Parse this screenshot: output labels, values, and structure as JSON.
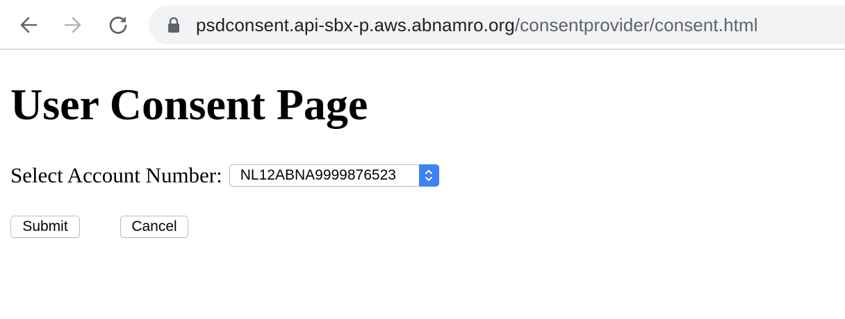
{
  "browser": {
    "url_host": "psdconsent.api-sbx-p.aws.abnamro.org",
    "url_path": "/consentprovider/consent.html",
    "back_icon": "arrow-left-icon",
    "forward_icon": "arrow-right-icon",
    "reload_icon": "reload-icon",
    "lock_icon": "lock-icon"
  },
  "page": {
    "title": "User Consent Page",
    "account_label": "Select Account Number:",
    "account_selected": "NL12ABNA9999876523",
    "submit_label": "Submit",
    "cancel_label": "Cancel"
  },
  "colors": {
    "select_accent": "#3d82f6",
    "omnibox_bg": "#f1f3f4"
  }
}
